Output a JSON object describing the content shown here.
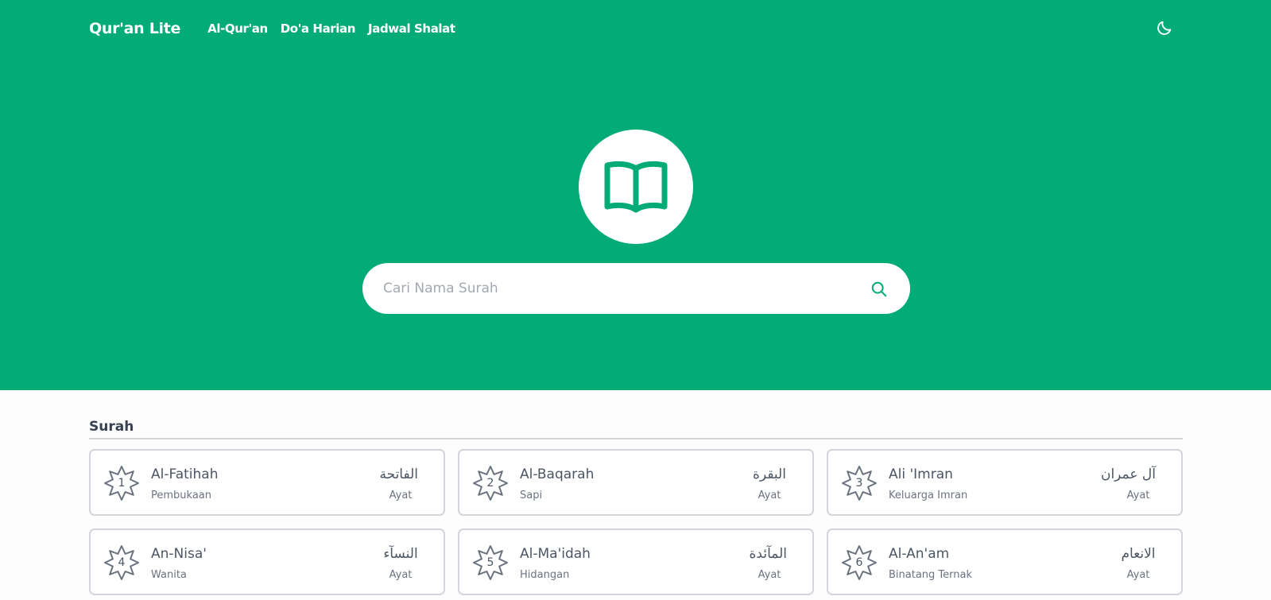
{
  "nav": {
    "brand": "Qur'an Lite",
    "links": [
      {
        "label": "Al-Qur'an"
      },
      {
        "label": "Do'a Harian"
      },
      {
        "label": "Jadwal Shalat"
      }
    ],
    "theme_icon": "moon-icon"
  },
  "hero": {
    "logo_icon": "open-book-icon",
    "search": {
      "placeholder": "Cari Nama Surah",
      "value": "",
      "icon": "search-icon"
    }
  },
  "section": {
    "title": "Surah"
  },
  "surahs": [
    {
      "number": "1",
      "latin": "Al-Fatihah",
      "meaning": "Pembukaan",
      "arabic": "الفاتحة",
      "ayat_label": "Ayat"
    },
    {
      "number": "2",
      "latin": "Al-Baqarah",
      "meaning": "Sapi",
      "arabic": "البقرة",
      "ayat_label": "Ayat"
    },
    {
      "number": "3",
      "latin": "Ali 'Imran",
      "meaning": "Keluarga Imran",
      "arabic": "آل عمران",
      "ayat_label": "Ayat"
    },
    {
      "number": "4",
      "latin": "An-Nisa'",
      "meaning": "Wanita",
      "arabic": "النسآء",
      "ayat_label": "Ayat"
    },
    {
      "number": "5",
      "latin": "Al-Ma'idah",
      "meaning": "Hidangan",
      "arabic": "المآئدة",
      "ayat_label": "Ayat"
    },
    {
      "number": "6",
      "latin": "Al-An'am",
      "meaning": "Binatang Ternak",
      "arabic": "الانعام",
      "ayat_label": "Ayat"
    }
  ],
  "colors": {
    "brand_green": "#03ab76",
    "card_border": "#d2d6dc",
    "text": "#4b5563"
  }
}
